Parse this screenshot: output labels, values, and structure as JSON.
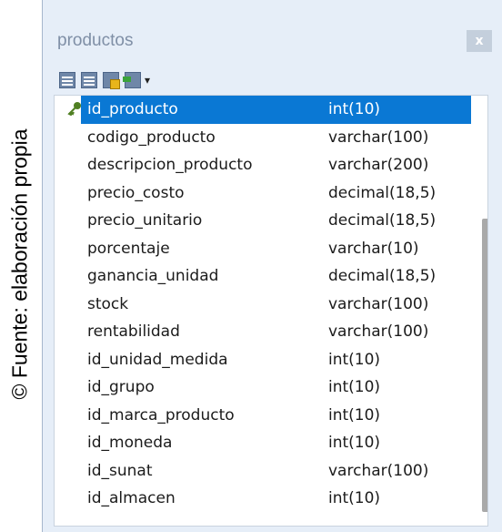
{
  "caption": "© Fuente: elaboración propia",
  "window": {
    "title": "productos",
    "close_label": "x"
  },
  "toolbar": {
    "icons": [
      "table-grid-icon",
      "table-columns-icon",
      "table-key-icon",
      "insert-column-icon"
    ],
    "dropdown_glyph": "▾"
  },
  "columns": [
    {
      "name": "id_producto",
      "type": "int(10)",
      "primary_key": true,
      "selected": true
    },
    {
      "name": "codigo_producto",
      "type": "varchar(100)"
    },
    {
      "name": "descripcion_producto",
      "type": "varchar(200)"
    },
    {
      "name": "precio_costo",
      "type": "decimal(18,5)"
    },
    {
      "name": "precio_unitario",
      "type": "decimal(18,5)"
    },
    {
      "name": "porcentaje",
      "type": "varchar(10)"
    },
    {
      "name": "ganancia_unidad",
      "type": "decimal(18,5)"
    },
    {
      "name": "stock",
      "type": "varchar(100)"
    },
    {
      "name": "rentabilidad",
      "type": "varchar(100)"
    },
    {
      "name": "id_unidad_medida",
      "type": "int(10)"
    },
    {
      "name": "id_grupo",
      "type": "int(10)"
    },
    {
      "name": "id_marca_producto",
      "type": "int(10)"
    },
    {
      "name": "id_moneda",
      "type": "int(10)"
    },
    {
      "name": "id_sunat",
      "type": "varchar(100)"
    },
    {
      "name": "id_almacen",
      "type": "int(10)"
    }
  ],
  "colors": {
    "selection": "#0a78d4",
    "window_bg": "#e6eef8",
    "title_text": "#7f8fa6",
    "key_icon": "#4f7f22"
  }
}
